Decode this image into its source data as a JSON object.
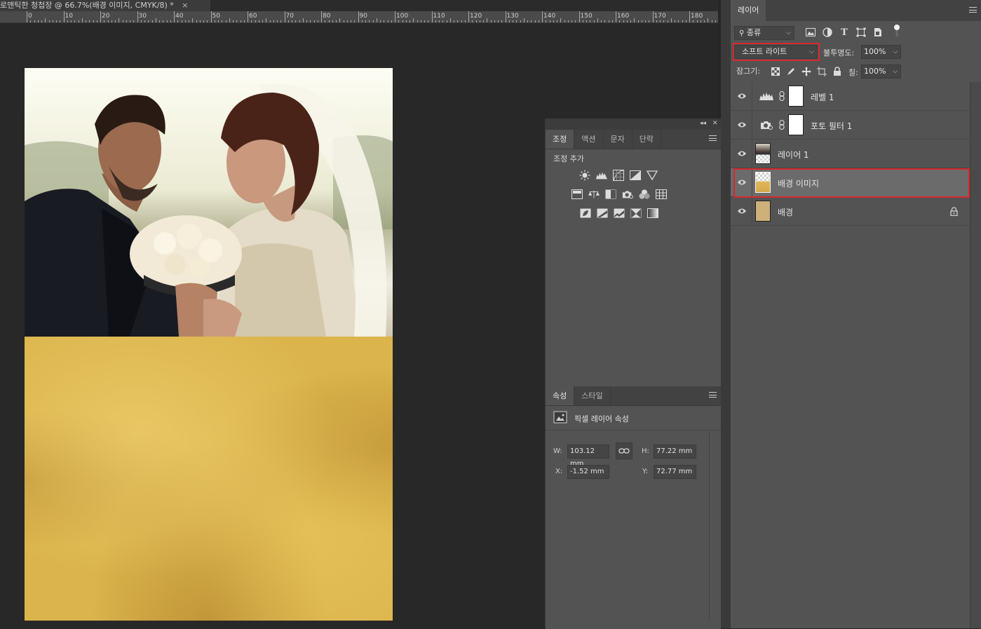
{
  "document": {
    "tab_title": "로맨틱한 청첩장 @ 66.7%(배경 이미지, CMYK/8) *",
    "close_glyph": "×"
  },
  "ruler": {
    "labels": [
      "0",
      "10",
      "20",
      "30",
      "40",
      "50",
      "60",
      "70",
      "80",
      "90",
      "100",
      "110",
      "120",
      "130",
      "140",
      "150",
      "160",
      "170",
      "180"
    ]
  },
  "adjustments_panel": {
    "tabs": [
      "조정",
      "액션",
      "문자",
      "단락"
    ],
    "active_tab": "조정",
    "title": "조정 추가",
    "icon_rows": [
      [
        "brightness-contrast-icon",
        "levels-icon",
        "curves-icon",
        "exposure-icon",
        "gradient-triangle-icon"
      ],
      [
        "vibrance-icon",
        "color-balance-icon",
        "black-white-icon",
        "photo-filter-icon",
        "channel-mixer-icon",
        "color-lookup-icon"
      ],
      [
        "invert-icon",
        "posterize-icon",
        "threshold-icon",
        "selective-color-icon",
        "gradient-map-icon"
      ]
    ]
  },
  "properties_panel": {
    "tabs": [
      "속성",
      "스타일"
    ],
    "active_tab": "속성",
    "header": "픽셀 레이어 속성",
    "w_label": "W:",
    "w_value": "103.12 mm",
    "h_label": "H:",
    "h_value": "77.22 mm",
    "x_label": "X:",
    "x_value": "-1.52 mm",
    "y_label": "Y:",
    "y_value": "72.77 mm"
  },
  "layers_panel": {
    "tab": "레이어",
    "filter_kind": "종류",
    "blend_mode": "소프트 라이트",
    "opacity_label": "불투명도:",
    "opacity_value": "100%",
    "lock_label": "잠그기:",
    "fill_label": "칠:",
    "fill_value": "100%",
    "layers": [
      {
        "name": "레벨 1",
        "type": "adjustment-levels",
        "visible": true,
        "selected": false
      },
      {
        "name": "포토 필터 1",
        "type": "adjustment-photo-filter",
        "visible": true,
        "selected": false
      },
      {
        "name": "레이어 1",
        "type": "pixel",
        "visible": true,
        "selected": false
      },
      {
        "name": "배경 이미지",
        "type": "pixel",
        "visible": true,
        "selected": true
      },
      {
        "name": "배경",
        "type": "background",
        "visible": true,
        "selected": false,
        "locked": true
      }
    ]
  },
  "colors": {
    "highlight": "#d7282b",
    "panel_bg": "#535353",
    "canvas_bg": "#282828",
    "paper": "#dbb44c"
  }
}
